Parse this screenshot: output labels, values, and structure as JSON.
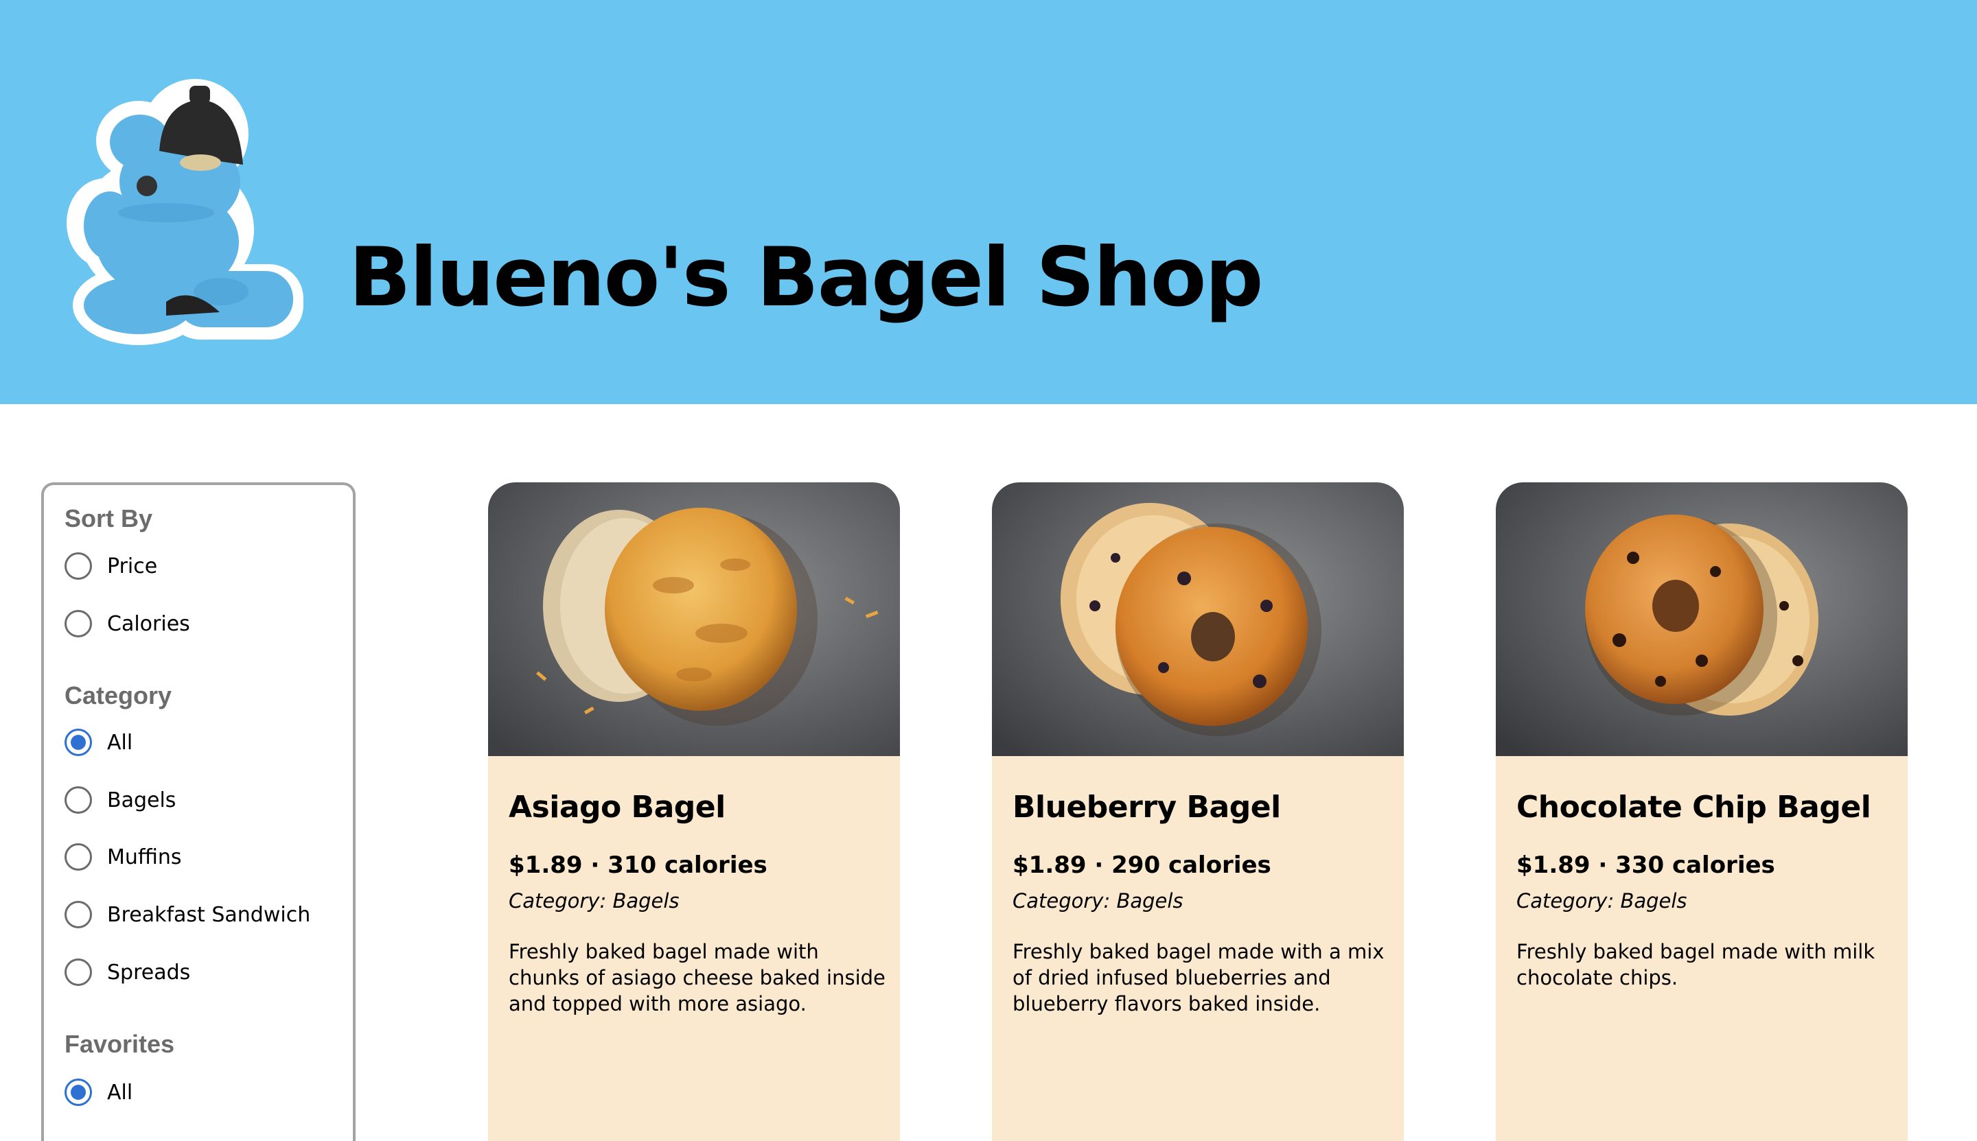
{
  "header": {
    "title": "Blueno's Bagel Shop",
    "background_color": "#6ac5f0",
    "logo_icon": "blueno-bear-lamp-icon"
  },
  "filters": {
    "sort_by": {
      "title": "Sort By",
      "options": [
        {
          "label": "Price",
          "selected": false
        },
        {
          "label": "Calories",
          "selected": false
        }
      ]
    },
    "category": {
      "title": "Category",
      "options": [
        {
          "label": "All",
          "selected": true
        },
        {
          "label": "Bagels",
          "selected": false
        },
        {
          "label": "Muffins",
          "selected": false
        },
        {
          "label": "Breakfast Sandwich",
          "selected": false
        },
        {
          "label": "Spreads",
          "selected": false
        }
      ]
    },
    "favorites": {
      "title": "Favorites",
      "options": [
        {
          "label": "All",
          "selected": true
        }
      ]
    },
    "accent_color": "#2e71d2"
  },
  "products": [
    {
      "name": "Asiago Bagel",
      "meta": "$1.89 · 310 calories",
      "category": "Category: Bagels",
      "description": "Freshly baked bagel made with chunks of asiago cheese baked inside and topped with more asiago.",
      "image_icon": "asiago-bagel-photo"
    },
    {
      "name": "Blueberry Bagel",
      "meta": "$1.89 · 290 calories",
      "category": "Category: Bagels",
      "description": "Freshly baked bagel made with a mix of dried infused blueberries and blueberry flavors baked inside.",
      "image_icon": "blueberry-bagel-photo"
    },
    {
      "name": "Chocolate Chip Bagel",
      "meta": "$1.89 · 330 calories",
      "category": "Category: Bagels",
      "description": "Freshly baked bagel made with milk chocolate chips.",
      "image_icon": "chocolate-chip-bagel-photo"
    }
  ],
  "card_color": "#fbe9cf"
}
